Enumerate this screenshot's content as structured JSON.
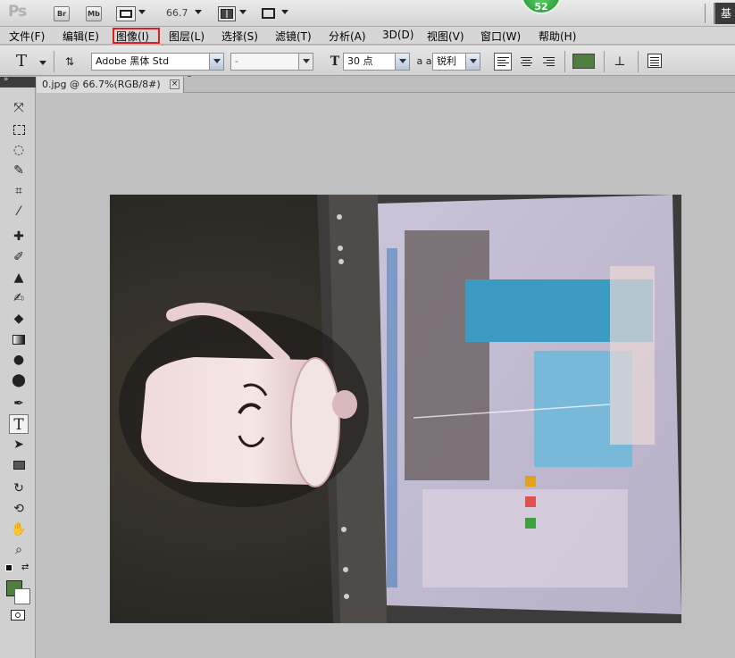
{
  "app": {
    "logo": "Ps",
    "bridge_label": "Br",
    "minibridge_label": "Mb",
    "zoom_value": "66.7",
    "notification_count": "52",
    "workspace_label": "基"
  },
  "menu": {
    "items": [
      "文件(F)",
      "编辑(E)",
      "图像(I)",
      "图层(L)",
      "选择(S)",
      "滤镜(T)",
      "分析(A)",
      "3D(D)",
      "视图(V)",
      "窗口(W)",
      "帮助(H)"
    ],
    "highlighted": "图像(I)"
  },
  "options": {
    "text_tool_label": "T",
    "font_family": "Adobe 黑体 Std",
    "font_style": "-",
    "font_size": "30 点",
    "antialias_label": "a a",
    "antialias": "锐利",
    "text_color": "#4f7f3f"
  },
  "toolbar": {
    "tools": [
      "move-tool-icon",
      "marquee-tool-icon",
      "lasso-tool-icon",
      "quick-select-tool-icon",
      "crop-tool-icon",
      "eyedropper-tool-icon",
      "healing-brush-tool-icon",
      "brush-tool-icon",
      "clone-stamp-tool-icon",
      "history-brush-tool-icon",
      "eraser-tool-icon",
      "gradient-tool-icon",
      "blur-tool-icon",
      "dodge-tool-icon",
      "pen-tool-icon",
      "type-tool-icon",
      "path-select-tool-icon",
      "shape-tool-icon",
      "3d-rotate-tool-icon",
      "3d-orbit-tool-icon",
      "hand-tool-icon",
      "zoom-tool-icon"
    ],
    "active_tool": "type-tool-icon",
    "foreground_color": "#4f7f3f",
    "background_color": "#ffffff"
  },
  "document": {
    "tab_title": "0.jpg @ 66.7%(RGB/8#)",
    "close_label": "×"
  }
}
